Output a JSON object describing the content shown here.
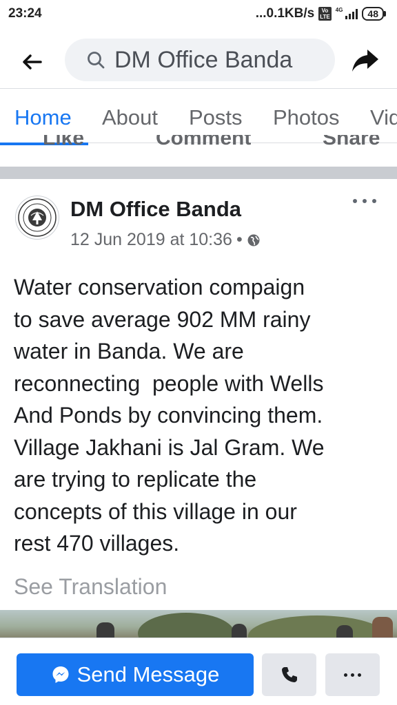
{
  "status_bar": {
    "time": "23:24",
    "net_speed": "...0.1KB/s",
    "volte": "Vo\nLTE",
    "network": "4G",
    "battery": "48"
  },
  "header": {
    "search_text": "DM Office Banda",
    "back_icon": "arrow-left-icon",
    "search_icon": "magnifier-icon",
    "share_icon": "share-arrow-icon"
  },
  "tabs": [
    {
      "label": "Home",
      "active": true
    },
    {
      "label": "About",
      "active": false
    },
    {
      "label": "Posts",
      "active": false
    },
    {
      "label": "Photos",
      "active": false
    },
    {
      "label": "Vid",
      "active": false
    }
  ],
  "action_row": {
    "like": "Like",
    "comment": "Comment",
    "share": "Share"
  },
  "post": {
    "author": "DM Office Banda",
    "timestamp": "12 Jun 2019 at 10:36",
    "separator": "•",
    "text": "Water conservation compaign\nto save average 902 MM rainy\nwater in Banda. We are\nreconnecting  people with Wells\nAnd Ponds by convincing them.\nVillage Jakhani is Jal Gram. We\nare trying to replicate the\nconcepts of this village in our\nrest 470 villages.",
    "see_translation": "See Translation"
  },
  "bottom_bar": {
    "send_message": "Send Message",
    "call_icon": "phone-icon",
    "more_icon": "ellipsis-icon"
  },
  "colors": {
    "accent": "#1877f2",
    "secondary_button": "#e4e6eb",
    "muted_text": "#65676b",
    "separator": "#c9ccd1"
  }
}
